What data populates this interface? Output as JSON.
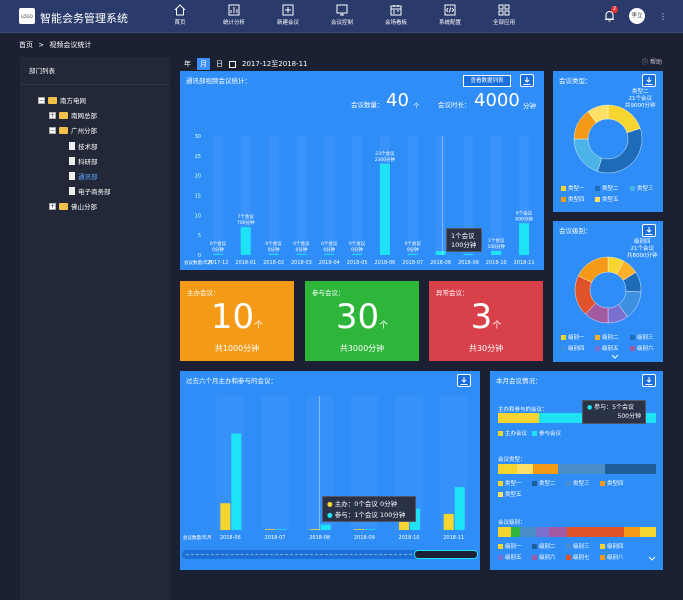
{
  "app": {
    "logo": "LOGO",
    "title": "智能会务管理系统"
  },
  "nav": [
    {
      "label": "首页",
      "icon": "home-icon"
    },
    {
      "label": "统计分析",
      "icon": "bar-chart-icon"
    },
    {
      "label": "新建会议",
      "icon": "add-meeting-icon"
    },
    {
      "label": "会议控制",
      "icon": "monitor-icon"
    },
    {
      "label": "会场看板",
      "icon": "calendar-icon"
    },
    {
      "label": "系统配置",
      "icon": "code-icon"
    },
    {
      "label": "全部应用",
      "icon": "grid-icon"
    }
  ],
  "header": {
    "badge": "2",
    "user": "李立",
    "more": "⋮"
  },
  "breadcrumb": {
    "home": "首页",
    "sep": ">",
    "current": "视频会议统计"
  },
  "sidebar": {
    "title": "部门列表",
    "tree": [
      {
        "label": "南方电网",
        "box": "−",
        "kind": "folder"
      },
      {
        "label": "南网总部",
        "box": "+",
        "kind": "folder"
      },
      {
        "label": "广州分部",
        "box": "−",
        "kind": "folder"
      },
      {
        "label": "技术部",
        "box": "",
        "kind": "doc"
      },
      {
        "label": "科研部",
        "box": "",
        "kind": "doc"
      },
      {
        "label": "通讯部",
        "box": "",
        "kind": "doc"
      },
      {
        "label": "电子商务部",
        "box": "",
        "kind": "doc"
      },
      {
        "label": "佛山分部",
        "box": "+",
        "kind": "folder"
      }
    ]
  },
  "filter": {
    "year": "年",
    "month": "月",
    "day": "日",
    "range": "2017-12至2018-11"
  },
  "help": "帮助",
  "main_panel": {
    "title": "通讯部视频会议统计：",
    "button": "查看数据列表",
    "count_label": "会议数量：",
    "count": "40",
    "count_unit": "个",
    "duration_label": "会议时长：",
    "duration": "4000",
    "duration_unit": "分钟",
    "axis_label": "会议数量/年月",
    "tooltip_line1": "1个会议",
    "tooltip_line2": "100分钟"
  },
  "stats": [
    {
      "label": "主办会议：",
      "value": "10",
      "unit": "个",
      "sub": "共1000分钟"
    },
    {
      "label": "参与会议：",
      "value": "30",
      "unit": "个",
      "sub": "共3000分钟"
    },
    {
      "label": "异常会议：",
      "value": "3",
      "unit": "个",
      "sub": "共30分钟"
    }
  ],
  "type_panel": {
    "title": "会议类型：",
    "center": [
      "类型二",
      "21个会议",
      "共9000分钟"
    ],
    "legend": [
      "类型一",
      "类型二",
      "类型三",
      "类型四",
      "类型五"
    ]
  },
  "level_panel": {
    "title": "会议级别：",
    "center": [
      "级别四",
      "21个会议",
      "共8000分钟"
    ],
    "legend": [
      "级别一",
      "级别二",
      "级别三",
      "级别四",
      "级别五",
      "级别六"
    ]
  },
  "six_panel": {
    "title": "过去六个月主办和参与的会议：",
    "axis_label": "会议数量/年月",
    "tip1": "主办：0个会议 0分钟",
    "tip2": "参与：1个会议 100分钟"
  },
  "month_panel": {
    "title": "本月会议情况：",
    "sec1": "主办和参与的会议：",
    "legend1": [
      "主办会议",
      "参与会议"
    ],
    "tip_line1": "参与：5个会议",
    "tip_line2": "500分钟",
    "sec2": "会议类型：",
    "legend2": [
      "类型一",
      "类型二",
      "类型三",
      "类型四",
      "类型五"
    ],
    "sec3": "会议级别：",
    "legend3": [
      "级别一",
      "级别二",
      "级别三",
      "级别四",
      "级别五",
      "级别六",
      "级别七",
      "级别八"
    ]
  },
  "colors": {
    "panel": "#2f8df8",
    "orange": "#f49a16",
    "green": "#2db63a",
    "red": "#d9414a",
    "bar": "#1de3f5",
    "yellow": "#f7d531"
  },
  "chart_data": [
    {
      "type": "bar",
      "title": "通讯部视频会议统计：",
      "ylim": [
        0,
        30
      ],
      "yticks": [
        0,
        5,
        10,
        15,
        20,
        25,
        30
      ],
      "categories": [
        "2017-12",
        "2018-01",
        "2018-02",
        "2018-03",
        "2018-04",
        "2018-05",
        "2018-06",
        "2018-07",
        "2018-08",
        "2018-09",
        "2018-10",
        "2018-11"
      ],
      "values": [
        0,
        7,
        0,
        0,
        0,
        0,
        23,
        0,
        1,
        0,
        1,
        8
      ],
      "labels": [
        [
          "0个会议",
          "0分钟"
        ],
        [
          "7个会议",
          "700分钟"
        ],
        [
          "0个会议",
          "0分钟"
        ],
        [
          "0个会议",
          "0分钟"
        ],
        [
          "0个会议",
          "0分钟"
        ],
        [
          "0个会议",
          "0分钟"
        ],
        [
          "23个会议",
          "2300分钟"
        ],
        [
          "0个会议",
          "0分钟"
        ],
        [
          "",
          ""
        ],
        [
          "",
          ""
        ],
        [
          "1个会议",
          "100分钟"
        ],
        [
          "8个会议",
          "800分钟"
        ]
      ]
    },
    {
      "type": "bar",
      "title": "过去六个月主办和参与的会议：",
      "categories": [
        "2018-06",
        "2018-07",
        "2018-08",
        "2018-09",
        "2018-10",
        "2018-11"
      ],
      "ylim": [
        0,
        25
      ],
      "series": [
        {
          "name": "主办",
          "color": "#f7d531",
          "values": [
            5,
            0,
            0,
            0,
            2,
            3
          ]
        },
        {
          "name": "参与",
          "color": "#1de3f5",
          "values": [
            18,
            0,
            1,
            0,
            4,
            8
          ]
        }
      ]
    },
    {
      "type": "pie",
      "title": "会议类型：",
      "slices": [
        {
          "label": "类型一",
          "value": 20,
          "color": "#f7d531"
        },
        {
          "label": "类型二",
          "value": 35,
          "color": "#1e6cb8"
        },
        {
          "label": "类型三",
          "value": 20,
          "color": "#4bb3e8"
        },
        {
          "label": "类型四",
          "value": 15,
          "color": "#f49a16"
        },
        {
          "label": "类型五",
          "value": 10,
          "color": "#ffe066"
        }
      ]
    },
    {
      "type": "pie",
      "title": "会议级别：",
      "slices": [
        {
          "label": "级别一",
          "value": 8,
          "color": "#f7d531"
        },
        {
          "label": "级别二",
          "value": 8,
          "color": "#ffb028"
        },
        {
          "label": "级别三",
          "value": 10,
          "color": "#1e6cb8"
        },
        {
          "label": "级别四",
          "value": 14,
          "color": "#3d8fe0"
        },
        {
          "label": "级别五",
          "value": 10,
          "color": "#7b6fd0"
        },
        {
          "label": "级别六",
          "value": 12,
          "color": "#a35aa0"
        },
        {
          "label": "级别七",
          "value": 20,
          "color": "#e0532a"
        },
        {
          "label": "级别八",
          "value": 18,
          "color": "#f49a16"
        }
      ]
    }
  ]
}
